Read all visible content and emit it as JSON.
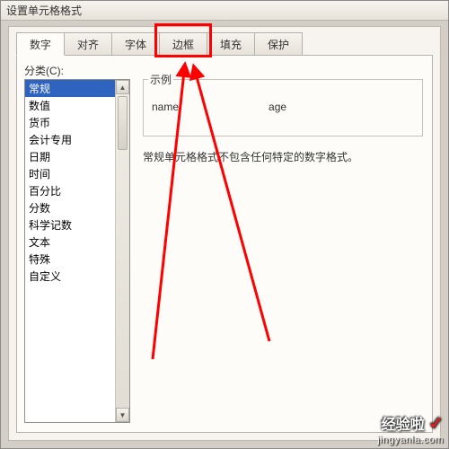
{
  "window": {
    "title": "设置单元格格式"
  },
  "tabs": [
    "数字",
    "对齐",
    "字体",
    "边框",
    "填充",
    "保护"
  ],
  "active_tab_index": 0,
  "highlighted_tab_index": 3,
  "category_label": "分类(C):",
  "categories": [
    "常规",
    "数值",
    "货币",
    "会计专用",
    "日期",
    "时间",
    "百分比",
    "分数",
    "科学记数",
    "文本",
    "特殊",
    "自定义"
  ],
  "selected_category_index": 0,
  "example_label": "示例",
  "example_values": {
    "col1": "name",
    "col2": "age"
  },
  "description": "常规单元格格式不包含任何特定的数字格式。",
  "scroll": {
    "up": "▲",
    "down": "▼"
  },
  "watermark": {
    "brand": "经验啦",
    "check": "✓",
    "url": "jingyanla.com"
  }
}
